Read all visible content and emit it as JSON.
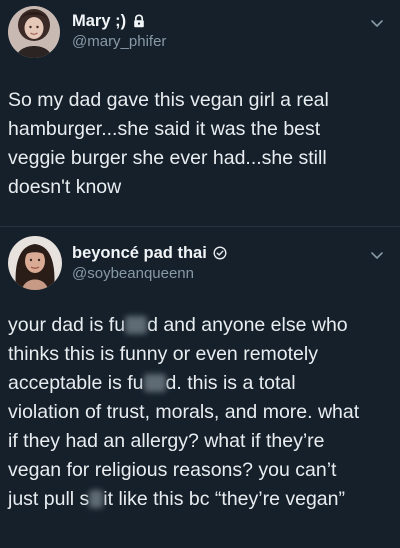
{
  "tweets": [
    {
      "author": {
        "display_name": "Mary ;)",
        "handle": "@mary_phifer",
        "badge": "lock-icon"
      },
      "text_lines": [
        "So my dad gave this vegan girl a real",
        "hamburger...she said it was the best",
        "veggie burger she ever had...she still",
        "doesn't know"
      ]
    },
    {
      "author": {
        "display_name": "beyoncé pad thai",
        "handle": "@soybeanqueenn",
        "badge": "circled-check-icon"
      },
      "text_lines": [
        [
          "your dad is fu",
          "d and anyone else who"
        ],
        "thinks this is funny or even remotely",
        [
          "acceptable is fu",
          "d. this is a total"
        ],
        "violation of trust, morals, and more. what",
        "if they had an allergy? what if they’re",
        "vegan for religious reasons? you can’t",
        [
          "just pull s",
          "it like this bc “they’re vegan”"
        ]
      ]
    }
  ],
  "colors": {
    "background": "#15202b",
    "text": "#e9edf0",
    "secondary_text": "#8899a6",
    "divider": "#243242"
  }
}
